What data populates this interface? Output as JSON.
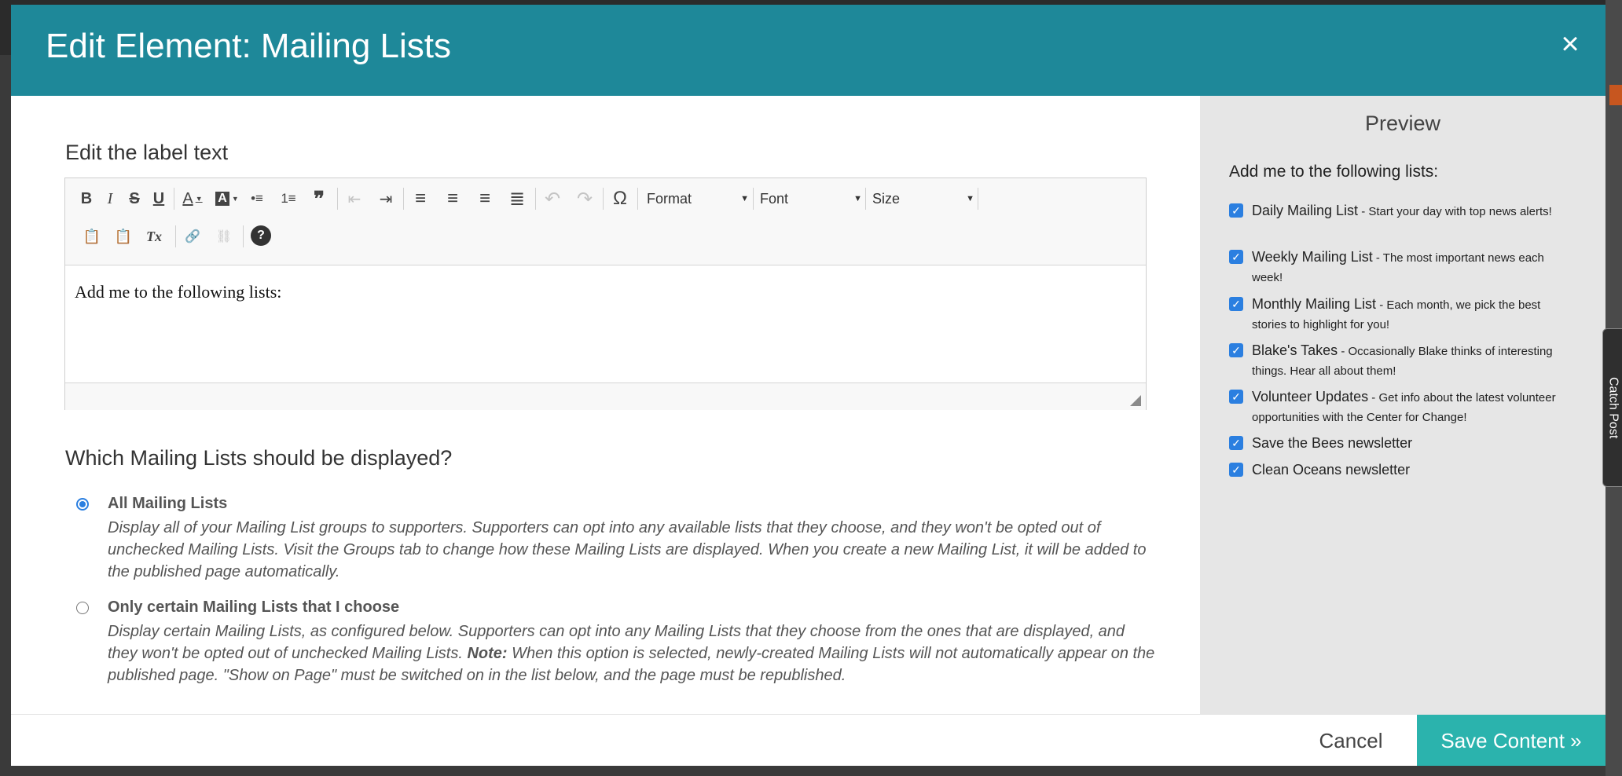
{
  "modal": {
    "title": "Edit Element: Mailing Lists",
    "close_symbol": "×"
  },
  "editor": {
    "label": "Edit the label text",
    "toolbar": {
      "buttons": [
        {
          "name": "bold-button",
          "icon": "bold-icon",
          "glyph": "B"
        },
        {
          "name": "italic-button",
          "icon": "italic-icon",
          "glyph": "I"
        },
        {
          "name": "strikethrough-button",
          "icon": "strikethrough-icon",
          "glyph": "S"
        },
        {
          "name": "underline-button",
          "icon": "underline-icon",
          "glyph": "U"
        },
        {
          "name": "text-color-button",
          "icon": "text-color-icon",
          "glyph": "A"
        },
        {
          "name": "bg-color-button",
          "icon": "background-color-icon",
          "glyph": "A"
        },
        {
          "name": "bulleted-list-button",
          "icon": "bulleted-list-icon",
          "glyph": "•≡"
        },
        {
          "name": "numbered-list-button",
          "icon": "numbered-list-icon",
          "glyph": "1≡"
        },
        {
          "name": "blockquote-button",
          "icon": "blockquote-icon",
          "glyph": "❞"
        },
        {
          "name": "outdent-button",
          "icon": "outdent-icon",
          "glyph": "⇤"
        },
        {
          "name": "indent-button",
          "icon": "indent-icon",
          "glyph": "⇥"
        },
        {
          "name": "align-left-button",
          "icon": "align-left-icon",
          "glyph": "≡"
        },
        {
          "name": "align-center-button",
          "icon": "align-center-icon",
          "glyph": "≡"
        },
        {
          "name": "align-right-button",
          "icon": "align-right-icon",
          "glyph": "≡"
        },
        {
          "name": "justify-button",
          "icon": "justify-icon",
          "glyph": "≣"
        },
        {
          "name": "undo-button",
          "icon": "undo-icon",
          "glyph": "↶"
        },
        {
          "name": "redo-button",
          "icon": "redo-icon",
          "glyph": "↷"
        },
        {
          "name": "special-char-button",
          "icon": "omega-icon",
          "glyph": "Ω"
        },
        {
          "name": "paste-text-button",
          "icon": "paste-text-icon",
          "glyph": "📋"
        },
        {
          "name": "paste-word-button",
          "icon": "paste-word-icon",
          "glyph": "📋"
        },
        {
          "name": "remove-format-button",
          "icon": "remove-format-icon",
          "glyph": "Tx"
        },
        {
          "name": "link-button",
          "icon": "link-icon",
          "glyph": "🔗"
        },
        {
          "name": "unlink-button",
          "icon": "unlink-icon",
          "glyph": "⛓"
        },
        {
          "name": "help-button",
          "icon": "help-icon",
          "glyph": "?"
        }
      ],
      "format_label": "Format",
      "font_label": "Font",
      "size_label": "Size",
      "caret_glyph": "▼"
    },
    "content": "Add me to the following lists:"
  },
  "display": {
    "question": "Which Mailing Lists should be displayed?",
    "options": [
      {
        "title": "All Mailing Lists",
        "selected": true,
        "description": "Display all of your Mailing List groups to supporters. Supporters can opt into any available lists that they choose, and they won't be opted out of unchecked Mailing Lists. Visit the Groups tab to change how these Mailing Lists are displayed. When you create a new Mailing List, it will be added to the published page automatically."
      },
      {
        "title": "Only certain Mailing Lists that I choose",
        "selected": false,
        "description_before": "Display certain Mailing Lists, as configured below. Supporters can opt into any Mailing Lists that they choose from the ones that are displayed, and they won't be opted out of unchecked Mailing Lists. ",
        "note_label": "Note:",
        "description_after": " When this option is selected, newly-created Mailing Lists will not automatically appear on the published page. \"Show on Page\" must be switched on in the list below, and the page must be republished."
      }
    ]
  },
  "preview": {
    "title": "Preview",
    "lead": "Add me to the following lists:",
    "check_glyph": "✓",
    "items": [
      {
        "name": "Daily Mailing List",
        "description": " - Start your day with top news alerts!"
      },
      {
        "name": "Weekly Mailing List",
        "description": " - The most important news each week!"
      },
      {
        "name": "Monthly Mailing List",
        "description": " - Each month, we pick the best stories to highlight for you!"
      },
      {
        "name": "Blake's Takes",
        "description": " - Occasionally Blake thinks of interesting things. Hear all about them!"
      },
      {
        "name": "Volunteer Updates",
        "description": " - Get info about the latest volunteer opportunities with the Center for Change!"
      },
      {
        "name": "Save the Bees newsletter",
        "description": ""
      },
      {
        "name": "Clean Oceans newsletter",
        "description": ""
      }
    ]
  },
  "side_tab": {
    "label": "Catch Post"
  },
  "footer": {
    "cancel_label": "Cancel",
    "save_label": "Save Content »"
  },
  "colors": {
    "header": "#1e8899",
    "save_button": "#2bb3ad",
    "checkbox": "#2b7fe0",
    "preview_bg": "#e6e6e6"
  }
}
